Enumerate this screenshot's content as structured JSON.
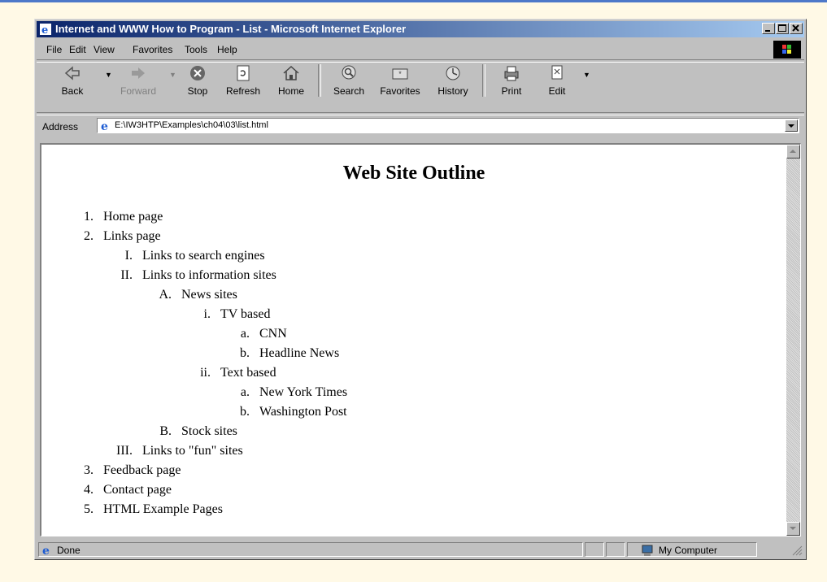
{
  "window": {
    "title": "Internet and WWW How to Program - List - Microsoft Internet Explorer"
  },
  "menu": [
    "File",
    "Edit",
    "View",
    "Favorites",
    "Tools",
    "Help"
  ],
  "toolbar": {
    "back": "Back",
    "forward": "Forward",
    "stop": "Stop",
    "refresh": "Refresh",
    "home": "Home",
    "search": "Search",
    "favorites": "Favorites",
    "history": "History",
    "print": "Print",
    "edit": "Edit"
  },
  "address": {
    "label": "Address",
    "url": "E:\\IW3HTP\\Examples\\ch04\\03\\list.html"
  },
  "page": {
    "heading": "Web Site Outline",
    "items": {
      "home": "Home page",
      "links": "Links page",
      "search_engines": "Links to search engines",
      "info_sites": "Links to information sites",
      "news_sites": "News sites",
      "tv_based": "TV based",
      "cnn": "CNN",
      "headline_news": "Headline News",
      "text_based": "Text based",
      "nyt": "New York Times",
      "wapo": "Washington Post",
      "stock_sites": "Stock sites",
      "fun_sites": "Links to \"fun\" sites",
      "feedback": "Feedback page",
      "contact": "Contact page",
      "html_examples": "HTML Example Pages"
    }
  },
  "status": {
    "text": "Done",
    "zone": "My Computer"
  }
}
